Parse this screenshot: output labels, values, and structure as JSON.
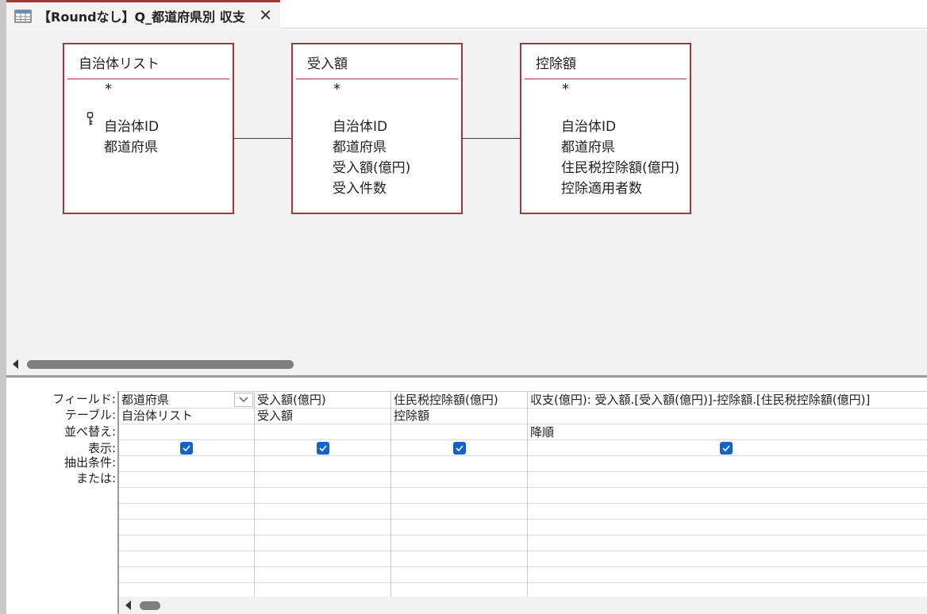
{
  "tab": {
    "title": "【Roundなし】Q_都道府県別 収支",
    "close_glyph": "✕",
    "accent_color": "#a4373a"
  },
  "tables": [
    {
      "title": "自治体リスト",
      "star": "*",
      "fields": [
        "自治体ID",
        "都道府県"
      ],
      "primary_key": "自治体ID"
    },
    {
      "title": "受入額",
      "star": "*",
      "fields": [
        "自治体ID",
        "都道府県",
        "受入額(億円)",
        "受入件数"
      ]
    },
    {
      "title": "控除額",
      "star": "*",
      "fields": [
        "自治体ID",
        "都道府県",
        "住民税控除額(億円)",
        "控除適用者数"
      ]
    }
  ],
  "grid": {
    "row_labels": [
      "フィールド:",
      "テーブル:",
      "並べ替え:",
      "表示:",
      "抽出条件:",
      "または:"
    ],
    "columns": [
      {
        "field": "都道府県",
        "table": "自治体リスト",
        "sort": "",
        "show": true,
        "has_dropdown": true
      },
      {
        "field": "受入額(億円)",
        "table": "受入額",
        "sort": "",
        "show": true
      },
      {
        "field": "住民税控除額(億円)",
        "table": "控除額",
        "sort": "",
        "show": true
      },
      {
        "field": "収支(億円): 受入額.[受入額(億円)]-控除額.[住民税控除額(億円)]",
        "table": "",
        "sort": "降順",
        "show": true
      }
    ],
    "checkbox_color": "#1164c8"
  }
}
